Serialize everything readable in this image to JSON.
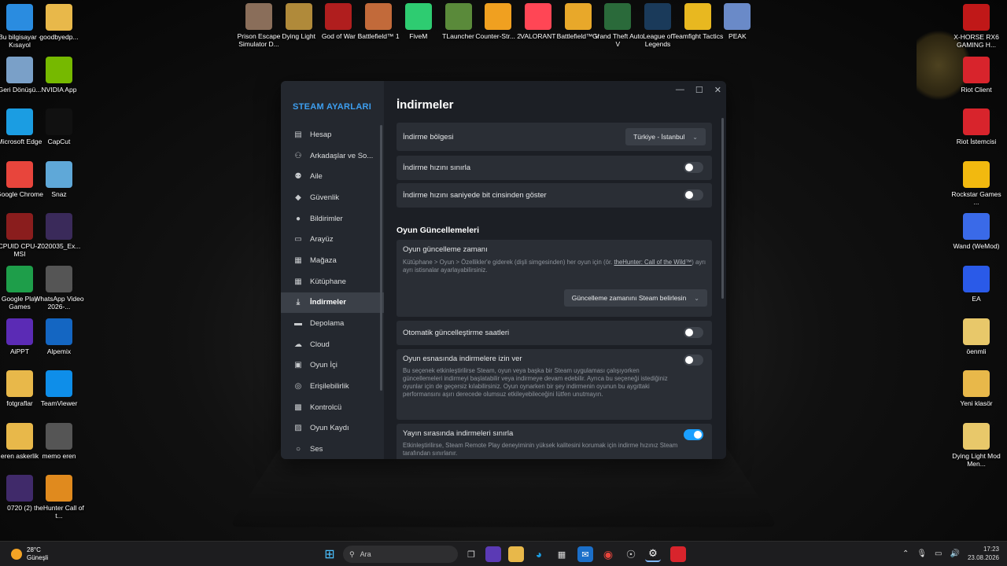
{
  "desktop": {
    "left_col1": [
      {
        "label": "Bu bilgisayar - Kısayol",
        "icon": "monitor-icon",
        "color": "#2a8ce0"
      },
      {
        "label": "Geri Dönüşü...",
        "icon": "recycle-bin-icon",
        "color": "#7aa0c8"
      },
      {
        "label": "Microsoft Edge",
        "icon": "edge-icon",
        "color": "#1b9de2"
      },
      {
        "label": "Google Chrome",
        "icon": "chrome-icon",
        "color": "#e8453c"
      },
      {
        "label": "CPUID CPU-Z MSI",
        "icon": "cpuz-icon",
        "color": "#8a1d1d"
      },
      {
        "label": "Google Play Games",
        "icon": "play-games-icon",
        "color": "#1e9e4a"
      },
      {
        "label": "AiPPT",
        "icon": "aippt-icon",
        "color": "#5b2bb5"
      },
      {
        "label": "fotgraflar",
        "icon": "folder-icon",
        "color": "#e8b84a"
      },
      {
        "label": "eren askerlik",
        "icon": "folder-icon",
        "color": "#e8b84a"
      },
      {
        "label": "0720 (2)",
        "icon": "video-file-icon",
        "color": "#402a6a"
      }
    ],
    "left_col2": [
      {
        "label": "goodbyedp...",
        "icon": "folder-icon",
        "color": "#e8b84a"
      },
      {
        "label": "NVIDIA App",
        "icon": "nvidia-icon",
        "color": "#76b900"
      },
      {
        "label": "CapCut",
        "icon": "capcut-icon",
        "color": "#111111"
      },
      {
        "label": "Snaz",
        "icon": "snaz-icon",
        "color": "#5fa8d8"
      },
      {
        "label": "7020035_Ex...",
        "icon": "video-file-icon",
        "color": "#3a2a5a"
      },
      {
        "label": "WhatsApp Video 2026-...",
        "icon": "video-file-icon",
        "color": "#555555"
      },
      {
        "label": "Alpemix",
        "icon": "alpemix-icon",
        "color": "#1466c2"
      },
      {
        "label": "TeamViewer",
        "icon": "teamviewer-icon",
        "color": "#0e8ee9"
      },
      {
        "label": "memo eren",
        "icon": "image-file-icon",
        "color": "#555555"
      },
      {
        "label": "theHunter Call of t...",
        "icon": "thehunter-icon",
        "color": "#e08a1e"
      }
    ],
    "top_row": [
      {
        "label": "Prison Escape Simulator D...",
        "icon": "prison-escape-icon",
        "color": "#8a6e5a"
      },
      {
        "label": "Dying Light",
        "icon": "dying-light-icon",
        "color": "#b08a3a"
      },
      {
        "label": "God of War",
        "icon": "god-of-war-icon",
        "color": "#b01e1e"
      },
      {
        "label": "Battlefield™ 1",
        "icon": "battlefield-icon",
        "color": "#c26a3a"
      },
      {
        "label": "FiveM",
        "icon": "fivem-icon",
        "color": "#2ecc71"
      },
      {
        "label": "TLauncher",
        "icon": "minecraft-icon",
        "color": "#5a8a3a"
      },
      {
        "label": "Counter-Str... 2",
        "icon": "cs2-icon",
        "color": "#f0a020"
      },
      {
        "label": "VALORANT",
        "icon": "valorant-icon",
        "color": "#ff4655"
      },
      {
        "label": "Battlefield™ V",
        "icon": "battlefield-v-icon",
        "color": "#e8a82a"
      },
      {
        "label": "Grand Theft Auto V",
        "icon": "gta-icon",
        "color": "#2a6a3a"
      },
      {
        "label": "League of Legends",
        "icon": "lol-icon",
        "color": "#1a3a5a"
      },
      {
        "label": "Teamfight Tactics",
        "icon": "tft-icon",
        "color": "#e8b820"
      },
      {
        "label": "PEAK",
        "icon": "peak-icon",
        "color": "#6a8ac8"
      }
    ],
    "right_col": [
      {
        "label": "X-HORSE RX6 GAMING H...",
        "icon": "msi-icon",
        "color": "#c01818"
      },
      {
        "label": "Riot Client",
        "icon": "riot-icon",
        "color": "#d8242c"
      },
      {
        "label": "Riot İstemcisi",
        "icon": "riot-icon",
        "color": "#d8242c"
      },
      {
        "label": "Rockstar Games ...",
        "icon": "rockstar-icon",
        "color": "#f2b90f"
      },
      {
        "label": "Wand (WeMod)",
        "icon": "wand-icon",
        "color": "#3a6ae8"
      },
      {
        "label": "EA",
        "icon": "ea-icon",
        "color": "#2a5ae8"
      },
      {
        "label": "öenmli",
        "icon": "folder-icon",
        "color": "#e8c86a"
      },
      {
        "label": "Yeni klasör",
        "icon": "folder-icon",
        "color": "#e8b84a"
      },
      {
        "label": "Dying Light Mod Men...",
        "icon": "folder-icon",
        "color": "#e8c86a"
      }
    ]
  },
  "steam": {
    "sidebar_title": "STEAM AYARLARI",
    "sidebar_items": [
      {
        "label": "Hesap",
        "icon": "id-card-icon"
      },
      {
        "label": "Arkadaşlar ve So...",
        "icon": "friends-icon"
      },
      {
        "label": "Aile",
        "icon": "family-icon"
      },
      {
        "label": "Güvenlik",
        "icon": "shield-icon"
      },
      {
        "label": "Bildirimler",
        "icon": "alert-icon"
      },
      {
        "label": "Arayüz",
        "icon": "monitor-icon"
      },
      {
        "label": "Mağaza",
        "icon": "cart-icon"
      },
      {
        "label": "Kütüphane",
        "icon": "grid-icon"
      },
      {
        "label": "İndirmeler",
        "icon": "download-icon"
      },
      {
        "label": "Depolama",
        "icon": "drive-icon"
      },
      {
        "label": "Cloud",
        "icon": "cloud-icon"
      },
      {
        "label": "Oyun İçi",
        "icon": "overlay-icon"
      },
      {
        "label": "Erişilebilirlik",
        "icon": "accessibility-icon"
      },
      {
        "label": "Kontrolcü",
        "icon": "gamepad-icon"
      },
      {
        "label": "Oyun Kaydı",
        "icon": "record-icon"
      },
      {
        "label": "Ses",
        "icon": "microphone-icon"
      }
    ],
    "active_item": "İndirmeler",
    "page_title": "İndirmeler",
    "download_region": {
      "label": "İndirme bölgesi",
      "value": "Türkiye - İstanbul"
    },
    "limit_speed": {
      "label": "İndirme hızını sınırla",
      "on": false
    },
    "bits_per_second": {
      "label": "İndirme hızını saniyede bit cinsinden göster",
      "on": false
    },
    "updates_section": "Oyun Güncellemeleri",
    "update_time": {
      "label": "Oyun güncelleme zamanı",
      "desc_pre": "Kütüphane > Oyun > Özellikler'e giderek (dişli simgesinden) her oyun için (ör. ",
      "desc_link": "theHunter: Call of the Wild™",
      "desc_post": ") ayrı ayrı istisnalar ayarlayabilirsiniz.",
      "dropdown": "Güncelleme zamanını Steam belirlesin"
    },
    "auto_update_hours": {
      "label": "Otomatik güncelleştirme saatleri",
      "on": false
    },
    "allow_during_game": {
      "label": "Oyun esnasında indirmelere izin ver",
      "desc": "Bu seçenek etkinleştirilirse Steam, oyun veya başka bir Steam uygulaması çalışıyorken güncellemeleri indirmeyi başlatabilir veya indirmeye devam edebilir. Ayrıca bu seçeneği istediğiniz oyunlar için de geçersiz kılabilirsiniz. Oyun oynarken bir şey indirmenin oyunun bu aygıttaki performansını aşırı derecede olumsuz etkileyebileceğini lütfen unutmayın.",
      "on": false
    },
    "throttle_streaming": {
      "label": "Yayın sırasında indirmeleri sınırla",
      "desc": "Etkinleştirilirse, Steam Remote Play deneyiminin yüksek kalitesini korumak için indirme hızınız Steam tarafından sınırlanır.",
      "on": true
    }
  },
  "taskbar": {
    "weather_temp": "28°C",
    "weather_desc": "Güneşli",
    "search_placeholder": "Ara",
    "time": "17:23",
    "date": "23.08.2026"
  }
}
